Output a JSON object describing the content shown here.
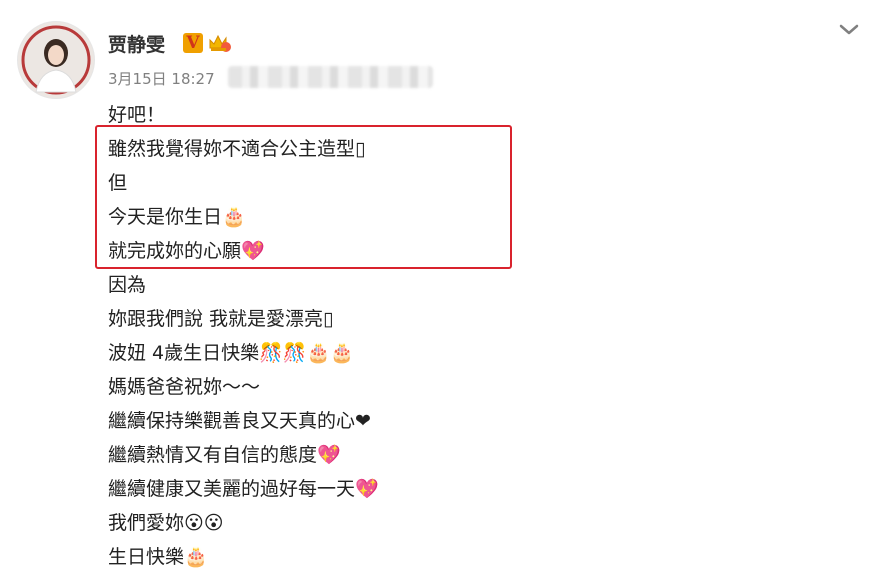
{
  "post": {
    "username": "贾静雯",
    "verified_label": "V",
    "timestamp": "3月15日 18:27",
    "lines": [
      "好吧！",
      "雖然我覺得妳不適合公主造型▯",
      "但",
      "今天是你生日🎂",
      "就完成妳的心願💖",
      "因為",
      "妳跟我們說 我就是愛漂亮▯",
      "波妞 4歲生日快樂🎊🎊🎂🎂",
      "媽媽爸爸祝妳～～",
      "繼續保持樂觀善良又天真的心❤",
      "繼續熱情又有自信的態度💖",
      "繼續健康又美麗的過好每一天💖",
      "我們愛妳😮😮",
      "生日快樂🎂"
    ]
  },
  "colors": {
    "highlight": "#d9232d",
    "verified_bg": "#f0a000",
    "verified_fg": "#d0341a",
    "meta_text": "#808080"
  },
  "icons": {
    "chevron": "chevron-down-icon",
    "vip": "crown-badge-icon",
    "verified": "verified-v-icon"
  }
}
